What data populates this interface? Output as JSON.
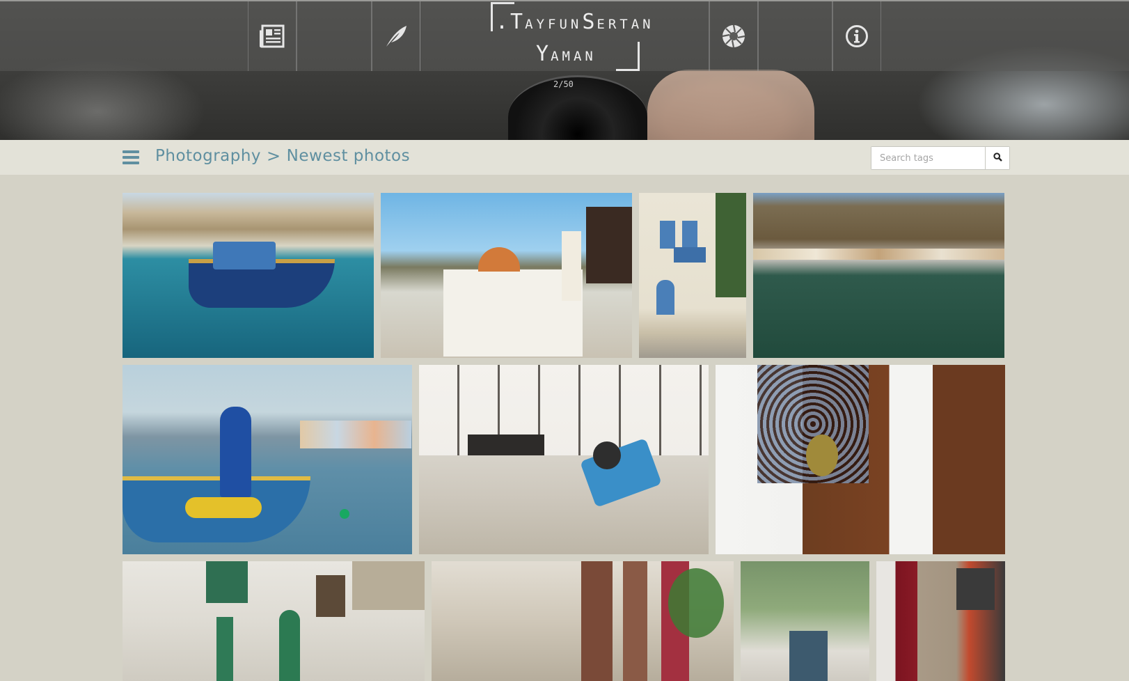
{
  "header": {
    "logo_line1_prefix": ".T",
    "logo_line1_small1": "AYFUN",
    "logo_line1_mid": "S",
    "logo_line1_small2": "ERTAN",
    "logo_line2_prefix": "Y",
    "logo_line2_small": "AMAN",
    "lens_marking": "2/50",
    "nav_icons": [
      "newspaper-icon",
      "feather-icon",
      "aperture-icon",
      "info-icon"
    ]
  },
  "breadcrumb": {
    "section": "Photography",
    "separator": ">",
    "page": "Newest photos"
  },
  "search": {
    "placeholder": "Search tags",
    "icon": "search-icon"
  },
  "gallery": {
    "photos": [
      {
        "subject": "blue fishing boat in harbor"
      },
      {
        "subject": "white church with bell tower"
      },
      {
        "subject": "white house with blue balcony"
      },
      {
        "subject": "harbor bay with clear green water"
      },
      {
        "subject": "blue boat with yellow nets"
      },
      {
        "subject": "grill and wheelbarrow against stone wall"
      },
      {
        "subject": "wooden window grille and brown door"
      },
      {
        "subject": "whitewashed alley with green shutters"
      },
      {
        "subject": "alley with wooden doors and plants"
      },
      {
        "subject": "shaded lane with trees"
      },
      {
        "subject": "red door and stone houses"
      }
    ]
  },
  "colors": {
    "accent": "#5f8fa0",
    "page_background": "#d4d2c6",
    "crumb_bar_background": "#e3e2d8"
  }
}
